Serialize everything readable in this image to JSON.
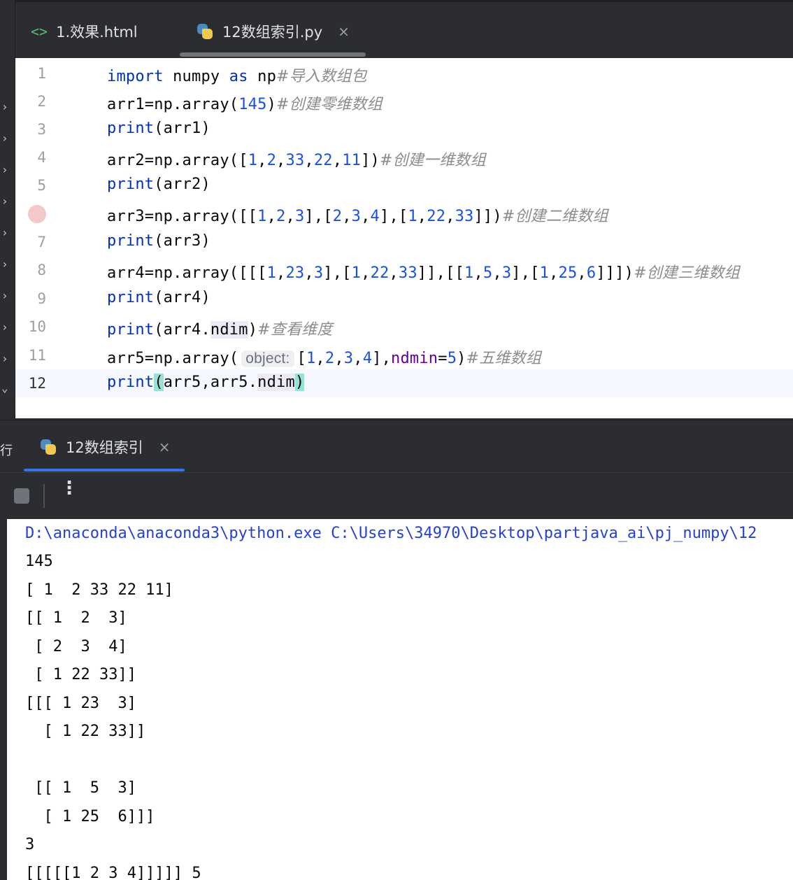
{
  "tabs": [
    {
      "label": "1.效果.html",
      "icon": "html-code-icon"
    },
    {
      "label": "12数组索引.py",
      "icon": "python-icon",
      "close": "×"
    }
  ],
  "editor": {
    "lines": [
      {
        "num": "1"
      },
      {
        "num": "2"
      },
      {
        "num": "3"
      },
      {
        "num": "4"
      },
      {
        "num": "5"
      },
      {
        "num": "",
        "breakpoint": true
      },
      {
        "num": "7"
      },
      {
        "num": "8"
      },
      {
        "num": "9"
      },
      {
        "num": "10"
      },
      {
        "num": "11"
      },
      {
        "num": "12"
      }
    ],
    "code": {
      "l1": {
        "kw1": "import",
        "t1": " numpy ",
        "kw2": "as",
        "t2": " np",
        "cm": "#导入数组包"
      },
      "l2": {
        "t1": "arr1=np.array(",
        "n1": "145",
        "t2": ")",
        "cm": "#创建零维数组"
      },
      "l3": {
        "fn": "print",
        "t1": "(arr1)"
      },
      "l4": {
        "t1": "arr2=np.array([",
        "n1": "1",
        "c1": ",",
        "n2": "2",
        "c2": ",",
        "n3": "33",
        "c3": ",",
        "n4": "22",
        "c4": ",",
        "n5": "11",
        "t2": "])",
        "cm": "#创建一维数组"
      },
      "l5": {
        "fn": "print",
        "t1": "(arr2)"
      },
      "l6": {
        "t1": "arr3=np.array([[",
        "n1": "1",
        "c1": ",",
        "n2": "2",
        "c2": ",",
        "n3": "3",
        "c3": "],[",
        "n4": "2",
        "c4": ",",
        "n5": "3",
        "c5": ",",
        "n6": "4",
        "c6": "],[",
        "n7": "1",
        "c7": ",",
        "n8": "22",
        "c8": ",",
        "n9": "33",
        "t2": "]])",
        "cm": "#创建二维数组"
      },
      "l7": {
        "fn": "print",
        "t1": "(arr3)"
      },
      "l8": {
        "t1": "arr4=np.array([[[",
        "n1": "1",
        "c1": ",",
        "n2": "23",
        "c2": ",",
        "n3": "3",
        "c3": "],[",
        "n4": "1",
        "c4": ",",
        "n5": "22",
        "c5": ",",
        "n6": "33",
        "c6": "]],[[",
        "n7": "1",
        "c7": ",",
        "n8": "5",
        "c8": ",",
        "n9": "3",
        "c9": "],[",
        "n10": "1",
        "c10": ",",
        "n11": "25",
        "c11": ",",
        "n12": "6",
        "t2": "]]])",
        "cm": "#创建三维数组"
      },
      "l9": {
        "fn": "print",
        "t1": "(arr4)"
      },
      "l10": {
        "fn": "print",
        "t1": "(arr4.",
        "attr": "ndim",
        "t2": ")",
        "cm": "#查看维度"
      },
      "l11": {
        "t1": "arr5=np.array(",
        "hint": "object:",
        "t2": "[",
        "n1": "1",
        "c1": ",",
        "n2": "2",
        "c2": ",",
        "n3": "3",
        "c3": ",",
        "n4": "4",
        "c4": "],",
        "kwarg": "ndmin",
        "eq": "=",
        "n5": "5",
        "t3": ")",
        "cm": "#五维数组"
      },
      "l12": {
        "fn": "print",
        "p1": "(",
        "t1": "arr5,arr5.",
        "attr": "ndim",
        "p2": ")"
      }
    }
  },
  "run": {
    "tab_label": "12数组索引",
    "tab_close": "×",
    "left_mark": "行",
    "more": "⋮"
  },
  "console": {
    "lines": [
      "D:\\anaconda\\anaconda3\\python.exe C:\\Users\\34970\\Desktop\\partjava_ai\\pj_numpy\\12",
      "145",
      "[ 1  2 33 22 11]",
      "[[ 1  2  3]",
      " [ 2  3  4]",
      " [ 1 22 33]]",
      "[[[ 1 23  3]",
      "  [ 1 22 33]]",
      "",
      " [[ 1  5  3]",
      "  [ 1 25  6]]]",
      "3",
      "[[[[[1 2 3 4]]]]] 5"
    ]
  },
  "colors": {
    "keyword": "#0033b3",
    "number": "#1750eb",
    "comment": "#8c8c8c",
    "kwarg": "#660099",
    "console_command": "#2541d4",
    "run_tab_accent": "#3574f0"
  }
}
